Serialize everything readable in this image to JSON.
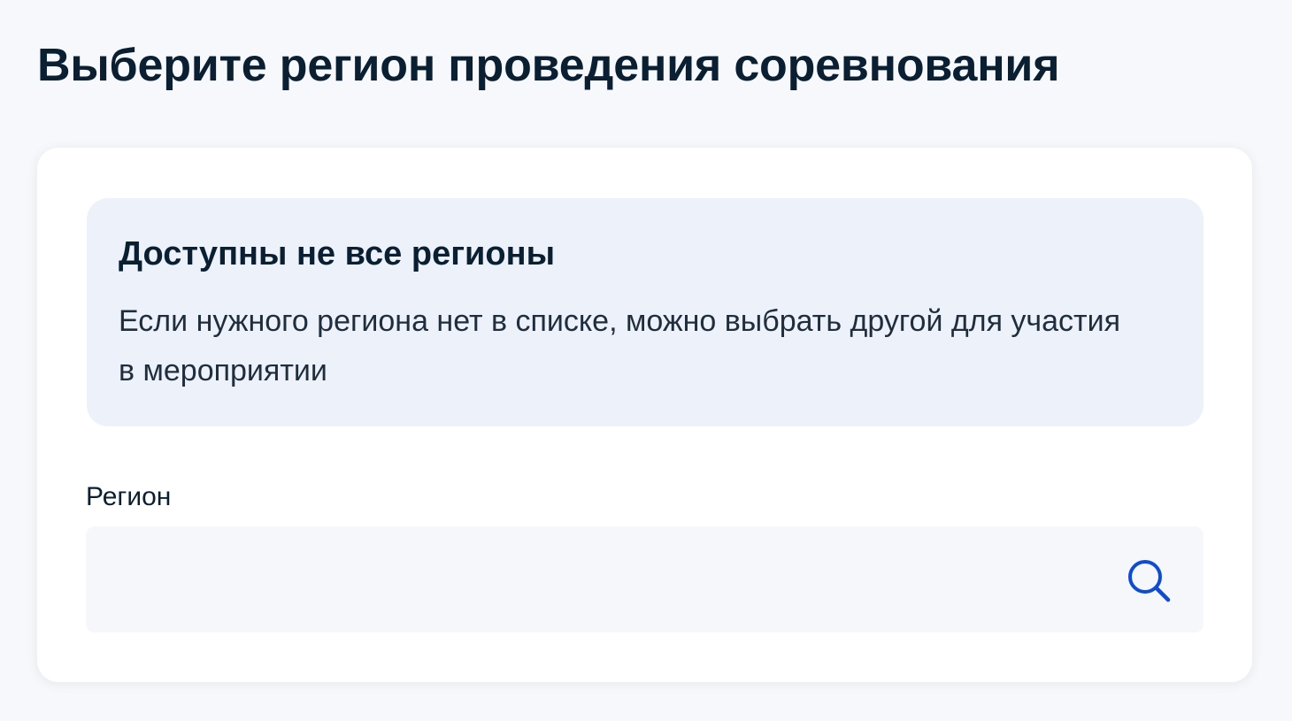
{
  "page": {
    "title": "Выберите регион проведения соревнования"
  },
  "notice": {
    "title": "Доступны не все регионы",
    "text": "Если нужного региона нет в списке, можно выбрать другой для участия в мероприятии"
  },
  "region_field": {
    "label": "Регион",
    "value": "",
    "placeholder": "",
    "icon": "search-icon"
  },
  "colors": {
    "page_background": "#f6f8fb",
    "card_background": "#ffffff",
    "notice_background": "#edf2fa",
    "input_background": "#f5f7fa",
    "text_primary": "#0b1f33",
    "accent_icon": "#0d4cd3"
  }
}
